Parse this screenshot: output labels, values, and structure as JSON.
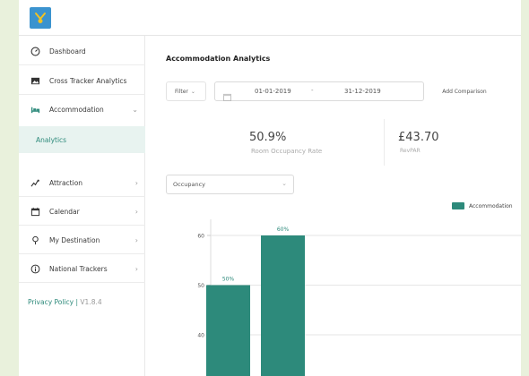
{
  "sidebar": {
    "items": [
      {
        "id": "dashboard",
        "label": "Dashboard",
        "icon": "dashboard-icon",
        "chevron": ""
      },
      {
        "id": "cross-tracker",
        "label": "Cross Tracker Analytics",
        "icon": "image-icon",
        "chevron": ""
      },
      {
        "id": "accommodation",
        "label": "Accommodation",
        "icon": "bed-icon",
        "chevron": "⌄"
      },
      {
        "id": "attraction",
        "label": "Attraction",
        "icon": "attraction-icon",
        "chevron": "›"
      },
      {
        "id": "calendar",
        "label": "Calendar",
        "icon": "calendar-icon",
        "chevron": "›"
      },
      {
        "id": "my-destination",
        "label": "My Destination",
        "icon": "map-pin-icon",
        "chevron": "›"
      },
      {
        "id": "national-trackers",
        "label": "National Trackers",
        "icon": "info-icon",
        "chevron": "›"
      }
    ],
    "sub_item": "Analytics",
    "footer": {
      "privacy": "Privacy Policy |",
      "version": "V1.8.4"
    }
  },
  "main": {
    "title": "Accommodation Analytics",
    "filter_label": "Filter",
    "date_from": "01-01-2019",
    "date_sep": "-",
    "date_to": "31-12-2019",
    "add_comparison": "Add Comparison",
    "stats": [
      {
        "value": "50.9%",
        "label": "Room Occupancy Rate"
      },
      {
        "value": "£43.70",
        "label": "RevPAR"
      }
    ],
    "metric_select": "Occupancy"
  },
  "colors": {
    "accent": "#2d8a7b",
    "logo": "#3b93cf",
    "page_bg": "#e9f1dc"
  },
  "chart_data": {
    "type": "bar",
    "categories": [
      "",
      ""
    ],
    "series": [
      {
        "name": "Accommodation",
        "values": [
          50,
          60
        ]
      }
    ],
    "data_labels": [
      "50%",
      "60%"
    ],
    "y_ticks": [
      40,
      50,
      60
    ],
    "ylim": [
      30,
      65
    ],
    "grid": true,
    "legend": "top-right"
  }
}
